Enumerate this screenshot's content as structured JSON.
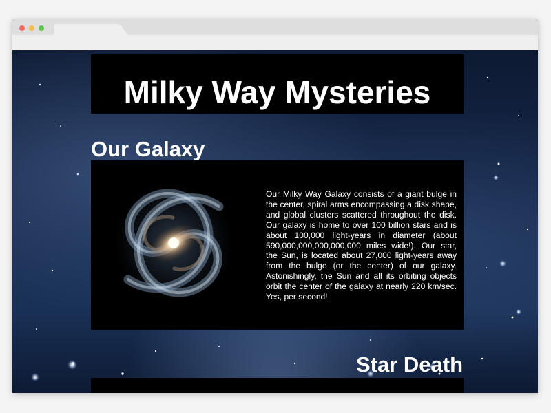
{
  "window": {
    "dot_colors": [
      "#ee6a5f",
      "#f5bd4f",
      "#61c454"
    ]
  },
  "page": {
    "title": "Milky Way Mysteries",
    "sections": [
      {
        "heading": "Our Galaxy",
        "image": "milky-way-galaxy-image",
        "body": "Our Milky Way Galaxy consists of a giant bulge in the center, spiral arms encompassing a disk shape, and global clusters scattered throughout the disk. Our galaxy is home to over 100 billion stars and is about 100,000 light-years in diameter (about 590,000,000,000,000,000 miles wide!). Our star, the Sun, is located about 27,000 light-years away from the bulge (or the center) of our galaxy. Astonishingly, the Sun and all its orbiting objects orbit the center of the galaxy at nearly 220 km/sec. Yes, per second!"
      },
      {
        "heading": "Star Death"
      }
    ]
  }
}
